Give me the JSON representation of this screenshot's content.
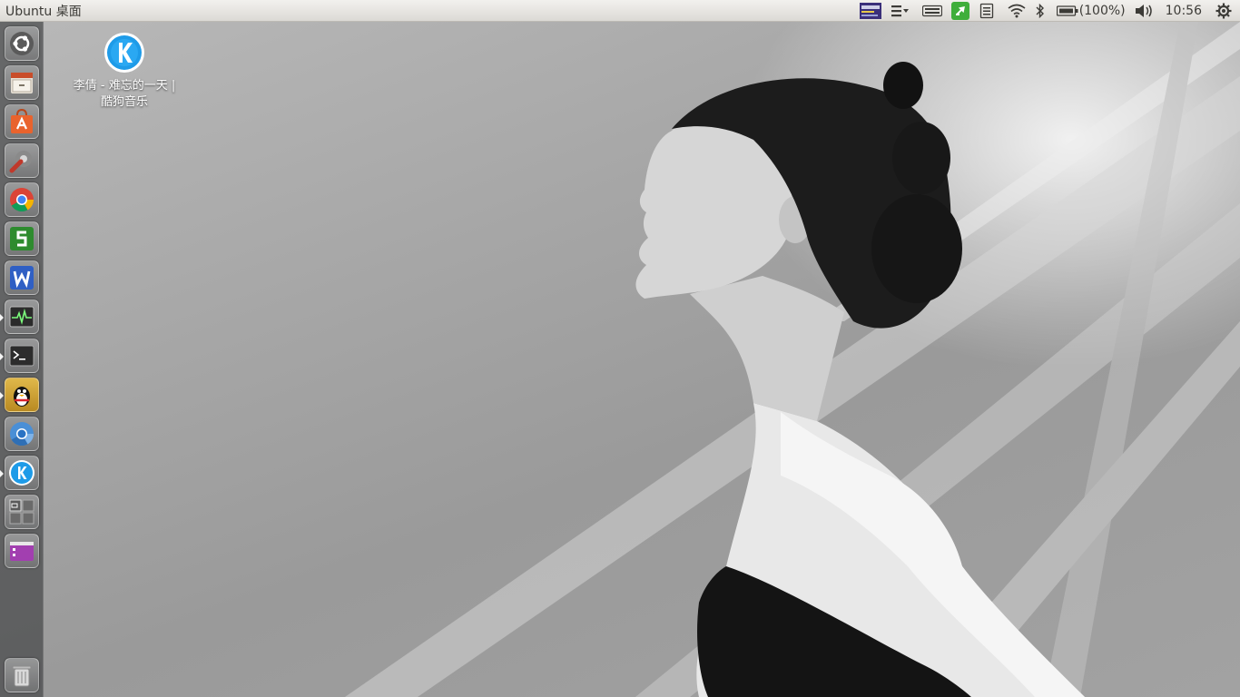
{
  "top_panel": {
    "title": "Ubuntu 桌面",
    "battery_text": "(100%)",
    "clock": "10:56"
  },
  "desktop_icon": {
    "label_line1": "李倩 - 难忘的一天 |",
    "label_line2": "酷狗音乐",
    "icon": "kugou-icon"
  },
  "launcher": {
    "items": [
      {
        "name": "dash-home",
        "icon": "ubuntu-logo-icon",
        "running": false
      },
      {
        "name": "files",
        "icon": "file-cabinet-icon",
        "running": false
      },
      {
        "name": "software-center",
        "icon": "shopping-bag-icon",
        "running": false
      },
      {
        "name": "system-settings",
        "icon": "wrench-gear-icon",
        "running": false
      },
      {
        "name": "chrome",
        "icon": "chrome-icon",
        "running": false
      },
      {
        "name": "wps-spreadsheets",
        "icon": "wps-s-icon",
        "running": false
      },
      {
        "name": "wps-writer",
        "icon": "wps-w-icon",
        "running": false
      },
      {
        "name": "system-monitor",
        "icon": "activity-monitor-icon",
        "running": true
      },
      {
        "name": "terminal",
        "icon": "terminal-icon",
        "running": true
      },
      {
        "name": "qq",
        "icon": "penguin-icon",
        "running": true
      },
      {
        "name": "chromium",
        "icon": "chromium-icon",
        "running": false
      },
      {
        "name": "kugou-music",
        "icon": "kugou-icon",
        "running": true
      },
      {
        "name": "workspace-switcher",
        "icon": "workspaces-icon",
        "running": false
      },
      {
        "name": "app-window",
        "icon": "window-icon",
        "running": false
      },
      {
        "name": "trash",
        "icon": "trash-icon",
        "running": false
      }
    ]
  },
  "colors": {
    "panel": "#dcdad5",
    "launcher": "#46484a",
    "kugou_blue": "#1e9be8",
    "ubuntu_orange": "#e9632d"
  }
}
